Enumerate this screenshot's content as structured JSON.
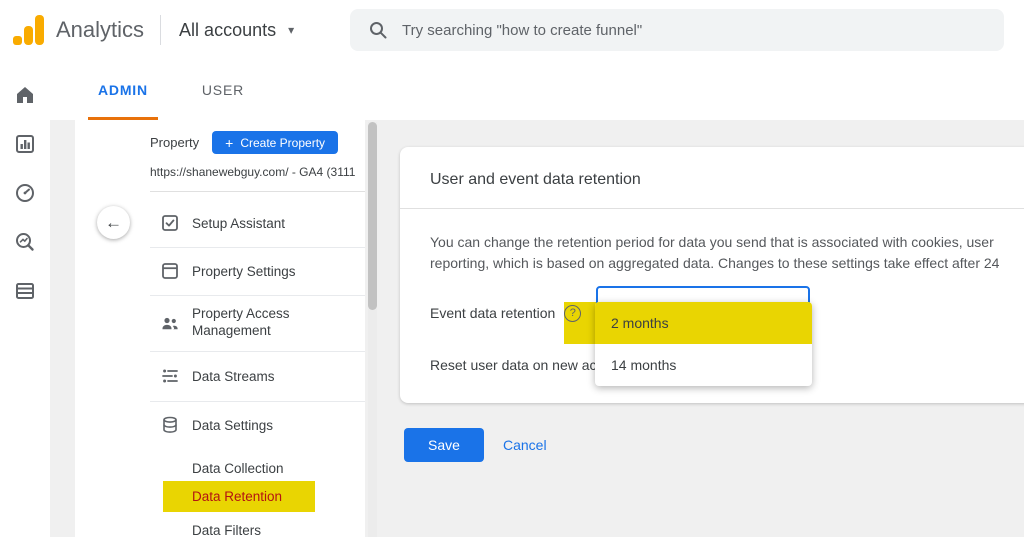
{
  "header": {
    "app_name": "Analytics",
    "account_selector": "All accounts",
    "search_placeholder": "Try searching \"how to create funnel\""
  },
  "icons": {
    "caret_down": "▾",
    "plus": "+",
    "back_arrow": "←",
    "help": "?"
  },
  "tabs": {
    "admin": "ADMIN",
    "user": "USER"
  },
  "admin_panel": {
    "section_label": "Property",
    "create_button_label": "Create Property",
    "property_selector": "https://shanewebguy.com/ - GA4 (3111...",
    "menu": [
      {
        "label": "Setup Assistant"
      },
      {
        "label": "Property Settings"
      },
      {
        "label": "Property Access Management"
      },
      {
        "label": "Data Streams"
      },
      {
        "label": "Data Settings"
      },
      {
        "label": "Data Collection"
      },
      {
        "label": "Data Retention"
      },
      {
        "label": "Data Filters"
      }
    ]
  },
  "content": {
    "card_title": "User and event data retention",
    "body_line1": "You can change the retention period for data you send that is associated with cookies, user",
    "body_line2": "reporting, which is based on aggregated data. Changes to these settings take effect after 24",
    "event_retention_label": "Event data retention",
    "reset_label": "Reset user data on new ac",
    "options": [
      {
        "label": "2 months"
      },
      {
        "label": "14 months"
      }
    ],
    "save_label": "Save",
    "cancel_label": "Cancel"
  },
  "colors": {
    "accent_blue": "#1a73e8",
    "tab_underline_orange": "#e8710a",
    "highlight_yellow": "#e9d502",
    "retention_text_red": "#b31412",
    "logo_orange": "#f9ab00"
  }
}
